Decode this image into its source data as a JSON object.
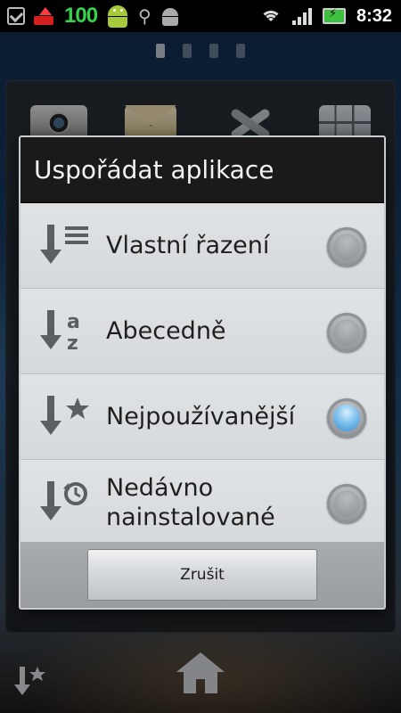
{
  "status_bar": {
    "battery_percent": "100",
    "time": "8:32",
    "icons": [
      "checkbox-icon",
      "notification-arrow-icon",
      "android-battery-icon",
      "usb-icon",
      "android-debug-icon",
      "wifi-icon",
      "signal-icon",
      "battery-charging-icon"
    ]
  },
  "page_indicator": {
    "count": 4,
    "active_index": 0
  },
  "dialog": {
    "title": "Uspořádat aplikace",
    "options": [
      {
        "label": "Vlastní řazení",
        "icon": "custom-sort-icon",
        "selected": false
      },
      {
        "label": "Abecedně",
        "icon": "alphabetical-sort-icon",
        "selected": false
      },
      {
        "label": "Nejpoužívanější",
        "icon": "most-used-sort-icon",
        "selected": true
      },
      {
        "label": "Nedávno nainstalované",
        "icon": "recently-installed-sort-icon",
        "selected": false
      }
    ],
    "cancel_label": "Zrušit"
  },
  "dock": {
    "icons": [
      "sort-favorites-icon",
      "home-icon"
    ]
  },
  "colors": {
    "accent_radio": "#3b8fd0",
    "status_green": "#33d34a",
    "title_bar": "#1a1a1a",
    "dialog_bg": "#d9dcdf"
  }
}
